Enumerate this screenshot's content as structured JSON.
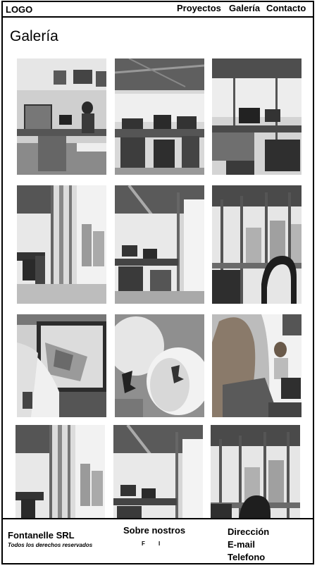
{
  "header": {
    "logo": "LOGO",
    "nav": [
      "Proyectos",
      "Galería",
      "Contacto"
    ]
  },
  "main": {
    "title": "Galería",
    "photos": [
      "office-workstations-photo",
      "office-desks-photo",
      "office-open-plan-photo",
      "office-window-corridor-photo",
      "office-industrial-ceiling-photo",
      "office-window-chair-photo",
      "laptop-site-plan-photo",
      "hard-hats-photo",
      "woman-at-computer-photo",
      "office-window-corridor-photo",
      "office-industrial-ceiling-photo",
      "office-window-chair-photo"
    ]
  },
  "footer": {
    "company": "Fontanelle SRL",
    "rights": "Todos los derechos reservados",
    "about": "Sobre nostros",
    "social": [
      "F",
      "I"
    ],
    "contact": [
      "Dirección",
      "E-mail",
      "Telefono"
    ]
  }
}
